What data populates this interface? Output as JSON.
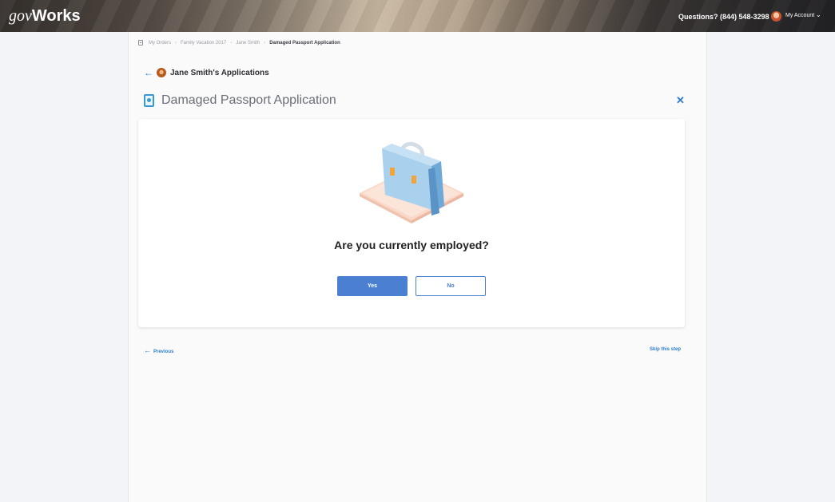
{
  "header": {
    "logo_gov": "gov",
    "logo_works": "Works",
    "questions": "Questions? (844) 548-3298",
    "account_label": "My Account",
    "account_chevron": "⌄"
  },
  "breadcrumb": {
    "items": [
      "My Orders",
      "Family Vacation 2017",
      "Jane Smith",
      "Damaged Passport Application"
    ],
    "separator": "›"
  },
  "back": {
    "arrow": "←",
    "title": "Jane Smith's Applications"
  },
  "page": {
    "title": "Damaged Passport Application",
    "close": "✕"
  },
  "question": {
    "text": "Are you currently employed?",
    "yes_label": "Yes",
    "no_label": "No"
  },
  "footer": {
    "previous_arrow": "←",
    "previous_label": "Previous",
    "skip_label": "Skip this step"
  },
  "colors": {
    "accent": "#4a7fd1",
    "link": "#2e7dc7",
    "passport_icon": "#3a98d3"
  },
  "icons": {
    "breadcrumb": "building-icon",
    "passport": "passport-icon",
    "illustration": "briefcase-icon"
  }
}
